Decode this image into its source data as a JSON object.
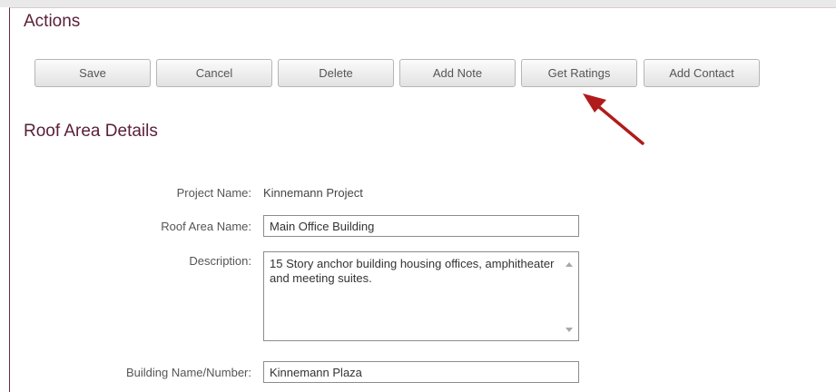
{
  "actions": {
    "title": "Actions",
    "buttons": {
      "save": "Save",
      "cancel": "Cancel",
      "delete": "Delete",
      "add_note": "Add Note",
      "get_ratings": "Get Ratings",
      "add_contact": "Add Contact"
    }
  },
  "roof_area": {
    "title": "Roof Area Details",
    "project_name": {
      "label": "Project Name:",
      "value": "Kinnemann Project"
    },
    "roof_area_name": {
      "label": "Roof Area Name:",
      "value": "Main Office Building"
    },
    "description": {
      "label": "Description:",
      "value": "15 Story anchor building housing offices, amphitheater and meeting suites."
    },
    "building_name": {
      "label": "Building Name/Number:",
      "value": "Kinnemann Plaza"
    }
  },
  "colors": {
    "heading": "#5a1f38",
    "panel_border": "#6b2b45",
    "annotation_arrow": "#b01c1c"
  }
}
